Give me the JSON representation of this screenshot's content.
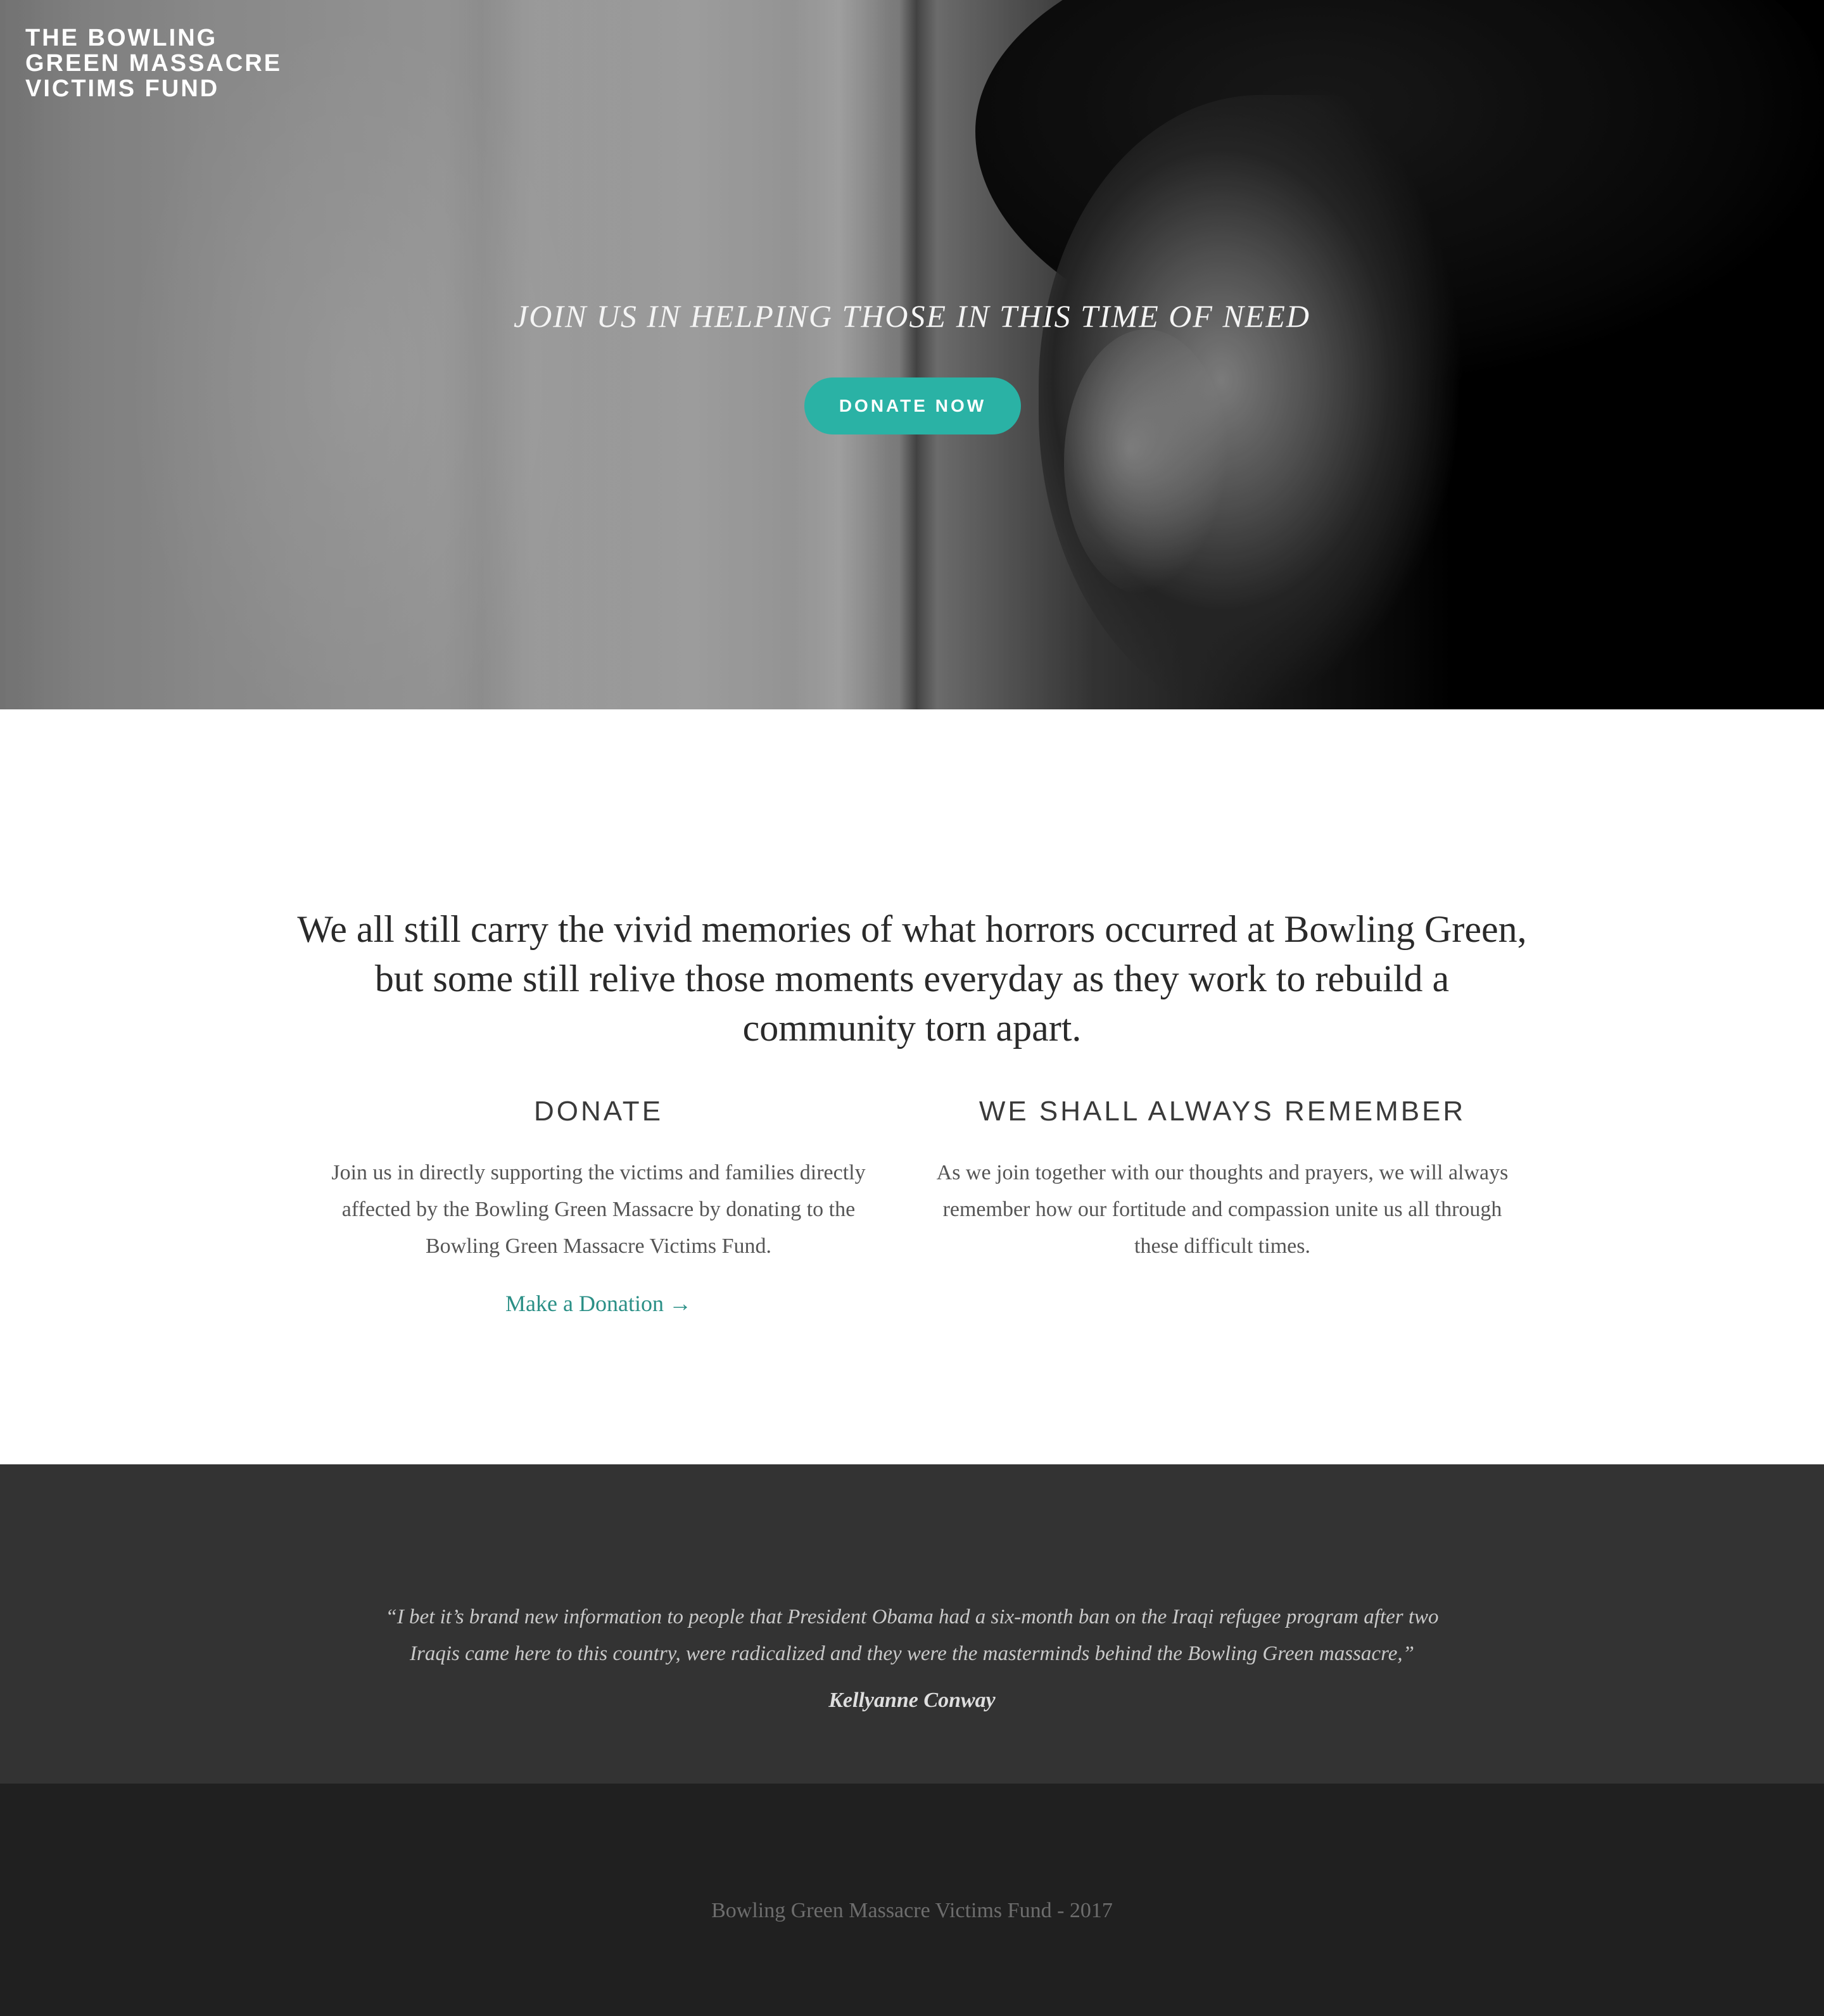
{
  "header": {
    "brand_lines": [
      "THE BOWLING",
      "GREEN MASSACRE",
      "VICTIMS FUND"
    ]
  },
  "hero": {
    "tagline": "JOIN US IN HELPING THOSE IN THIS TIME OF NEED",
    "cta_label": "DONATE NOW"
  },
  "intro": {
    "text": "We all still carry the vivid memories of what horrors occurred at Bowling Green, but some still relive those moments everyday as they work to rebuild a community torn apart."
  },
  "features": [
    {
      "title": "DONATE",
      "body": "Join us in directly supporting the victims and families directly affected by the Bowling Green Massacre by donating to the Bowling Green Massacre Victims Fund.",
      "link_label": "Make a Donation",
      "link_icon": "→"
    },
    {
      "title": "WE SHALL ALWAYS REMEMBER",
      "body": "As we join together with our thoughts and prayers, we will always remember how our fortitude and compassion unite us all through these difficult times."
    }
  ],
  "quote": {
    "text": "“I bet it’s brand new information to people that President Obama had a six-month ban on the Iraqi refugee program after two Iraqis came here to this country, were radicalized and they were the masterminds behind the Bowling Green massacre,”",
    "author": "Kellyanne Conway"
  },
  "footer": {
    "text": "Bowling Green Massacre Victims Fund - 2017"
  },
  "colors": {
    "accent": "#2ab2a5",
    "link": "#2a8f86",
    "quote_bg": "#333333",
    "footer_bg": "#202020"
  },
  "images": {
    "hero_photo": "portrait-looking-out-window-icon"
  }
}
